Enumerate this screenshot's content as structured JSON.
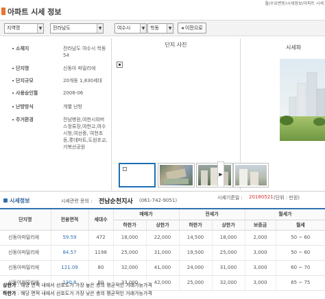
{
  "breadcrumb": "월/수요변동)시세정보/아파트 시세",
  "page_title": "아파트 시세 정보",
  "filters": {
    "region_select": "지역명",
    "province_select": "전라남도",
    "city_select": "여수시",
    "dong_select": "학동",
    "prev_button": "이전으로"
  },
  "info": {
    "rows": [
      {
        "label": "소재지",
        "value": "전라남도 여수시 학동 54"
      },
      {
        "label": "단지명",
        "value": "신동아 파밀리에"
      },
      {
        "label": "단지규모",
        "value": "20개동 1,830세대"
      },
      {
        "label": "사용승인월",
        "value": "2008-06"
      },
      {
        "label": "난방방식",
        "value": "개별 난방"
      },
      {
        "label": "주거환경",
        "value": "전남병원,여천시외버스정류장,여천고,여수시청,여선중, 여천초등,롯데마트,도원초교,거북선공원"
      }
    ],
    "photo_title": "단지 사진",
    "sise_title": "시세파"
  },
  "section": {
    "title": "시세정보",
    "contact_label": "시세관련 문의 :",
    "contact_office": "전남순천지사",
    "contact_phone": "(061-742-9051)",
    "basis_label": "시세기준일 :",
    "basis_date": "20180521",
    "unit_label": "(단위 : 만원)"
  },
  "table": {
    "group_headers": {
      "sale": "매매가",
      "jeonse": "전세가",
      "monthly": "월세가"
    },
    "headers": {
      "complex": "단지명",
      "area": "전용면적",
      "households": "세대수",
      "sale_low": "하한가",
      "sale_high": "상한가",
      "jeonse_low": "하한가",
      "jeonse_high": "상한가",
      "deposit": "보증금",
      "rent": "월세"
    },
    "rows": [
      {
        "complex": "신동아파밀리에",
        "area": "59.59",
        "households": "472",
        "sale_low": "18,000",
        "sale_high": "22,000",
        "jeonse_low": "14,500",
        "jeonse_high": "18,000",
        "deposit": "2,000",
        "rent": "50 ~ 60"
      },
      {
        "complex": "신동아파밀리에",
        "area": "84.57",
        "households": "1198",
        "sale_low": "25,000",
        "sale_high": "31,000",
        "jeonse_low": "19,500",
        "jeonse_high": "25,000",
        "deposit": "3,000",
        "rent": "50 ~ 60"
      },
      {
        "complex": "신동아파밀리에",
        "area": "121.09",
        "households": "80",
        "sale_low": "32,000",
        "sale_high": "41,000",
        "jeonse_low": "24,000",
        "jeonse_high": "31,000",
        "deposit": "3,000",
        "rent": "60 ~ 70"
      },
      {
        "complex": "신동아파밀리에",
        "area": "130.8",
        "households": "80",
        "sale_low": "33,000",
        "sale_high": "42,000",
        "jeonse_low": "25,000",
        "jeonse_high": "32,000",
        "deposit": "3,000",
        "rent": "65 ~ 75"
      }
    ]
  },
  "notes": [
    {
      "key": "상한가",
      "text": ": 해당 면적 내에서 선호도가 가장 높은 층의 평균적인 거래가능가격"
    },
    {
      "key": "하한가",
      "text": ": 해당 면적 내에서 선호도가 가장 낮은 층의 평균적인 거래가능가격"
    }
  ],
  "colors": {
    "accent": "#e8732f",
    "link": "#2f6fb0",
    "date": "#d2322d"
  }
}
